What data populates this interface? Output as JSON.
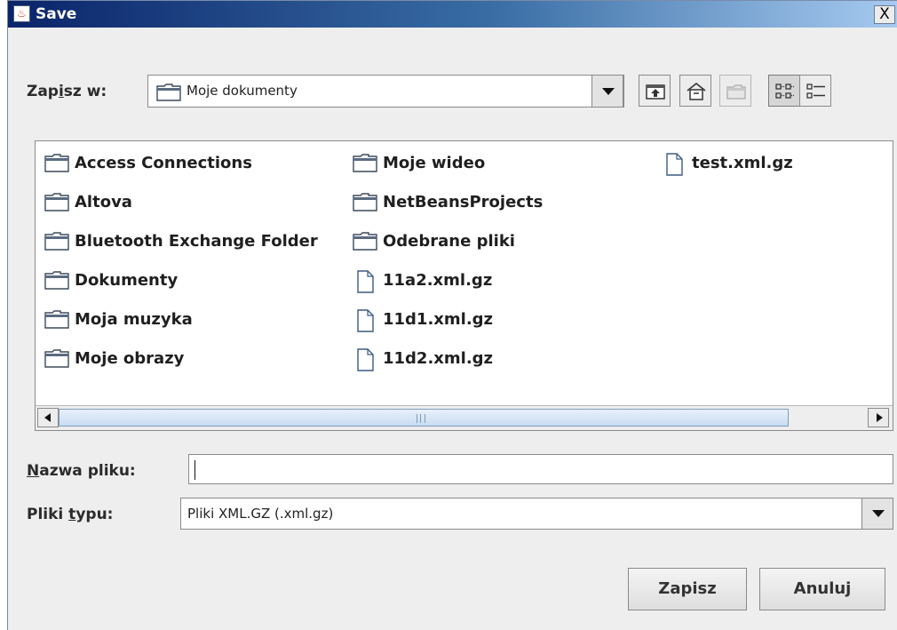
{
  "dialog": {
    "title": "Save",
    "close_label": "X"
  },
  "save_in": {
    "label_pre": "Zap",
    "label_mnemonic": "i",
    "label_post": "sz w:",
    "current_folder": "Moje dokumenty"
  },
  "toolbar": {
    "buttons": [
      {
        "name": "up-one-level",
        "icon": "folder-up-icon",
        "enabled": true
      },
      {
        "name": "home",
        "icon": "home-icon",
        "enabled": true
      },
      {
        "name": "create-new-folder",
        "icon": "new-folder-icon",
        "enabled": false
      },
      {
        "name": "list-view",
        "icon": "list-view-icon",
        "enabled": true,
        "selected": true
      },
      {
        "name": "details-view",
        "icon": "details-view-icon",
        "enabled": true,
        "selected": false
      }
    ]
  },
  "files": [
    {
      "name": "Access Connections",
      "type": "folder"
    },
    {
      "name": "Altova",
      "type": "folder"
    },
    {
      "name": "Bluetooth Exchange Folder",
      "type": "folder"
    },
    {
      "name": "Dokumenty",
      "type": "folder"
    },
    {
      "name": "Moja muzyka",
      "type": "folder"
    },
    {
      "name": "Moje obrazy",
      "type": "folder"
    },
    {
      "name": "Moje wideo",
      "type": "folder"
    },
    {
      "name": "NetBeansProjects",
      "type": "folder"
    },
    {
      "name": "Odebrane pliki",
      "type": "folder"
    },
    {
      "name": "11a2.xml.gz",
      "type": "file"
    },
    {
      "name": "11d1.xml.gz",
      "type": "file"
    },
    {
      "name": "11d2.xml.gz",
      "type": "file"
    },
    {
      "name": "test.xml.gz",
      "type": "file"
    }
  ],
  "filename": {
    "label_mnemonic": "N",
    "label_post": "azwa pliku:",
    "value": ""
  },
  "filetype": {
    "label_pre": "Pliki ",
    "label_mnemonic": "t",
    "label_post": "ypu:",
    "selected": "Pliki XML.GZ (.xml.gz)"
  },
  "actions": {
    "save_label": "Zapisz",
    "cancel_label": "Anuluj"
  },
  "colors": {
    "titlebar_start": "#0a246a",
    "titlebar_end": "#a6caf0",
    "dialog_bg": "#eeeeee",
    "scroll_thumb": "#c9dcf2"
  }
}
